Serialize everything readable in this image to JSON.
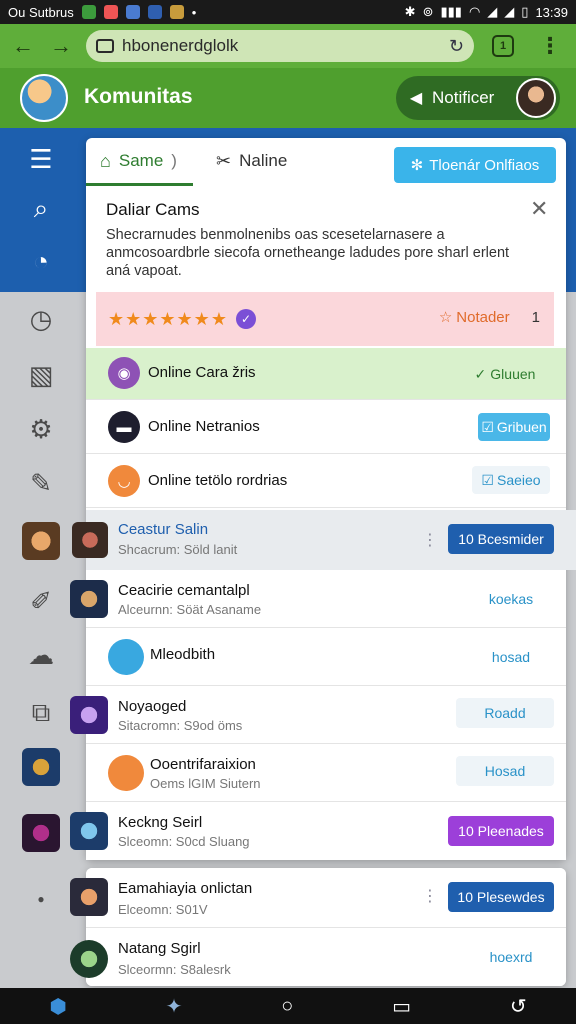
{
  "statusbar": {
    "carrier": "Ou Sutbrus",
    "time": "13:39"
  },
  "browser": {
    "url": "hbonenerdglolk"
  },
  "app": {
    "title": "Komunitas",
    "notif_label": "Notificer"
  },
  "tabs": [
    {
      "label": "Same",
      "active": true
    },
    {
      "label": "Naline",
      "active": false
    }
  ],
  "filter_button": "Tloenár Onlfiaos",
  "dialog": {
    "title": "Daliar Cams",
    "description": "Shecrarnudes benmolnenibs oas scesetelarnasere a anmcosoardbrle siecofa ornetheange ladudes pore sharl erlent aná vapoat."
  },
  "rating": {
    "stars": "★★★★★★★",
    "right_label": "Notader",
    "count": "1"
  },
  "online_rows": [
    {
      "label": "Online Cara žris",
      "action": "Gluuen",
      "icon_color": "#9b59b6"
    },
    {
      "label": "Online Netranios",
      "action": "Gribuen",
      "icon_color": "#1e1e2e"
    },
    {
      "label": "Online tetölo rordrias",
      "action": "Saeieo",
      "icon_color": "#f0893c"
    }
  ],
  "list": [
    {
      "name": "Ceastur Salin",
      "sub": "Shcacrum: Söld lanit",
      "button": "10 Bcesmider"
    },
    {
      "name": "Ceacirie cemantalpl",
      "sub": "Alceurnn: Söät Asaname",
      "button": "koekas"
    },
    {
      "name": "Mleodbith",
      "sub": "",
      "button": "hosad"
    },
    {
      "name": "Noyaoged",
      "sub": "Sitacromn: S9od öms",
      "button": "Roadd"
    },
    {
      "name": "Ooentrifaraixion",
      "sub": "Oems lGIM Siutern",
      "button": "Hosad"
    },
    {
      "name": "Keckng Seirl",
      "sub": "Slceomn: S0cd Sluang",
      "button": "10 Pleenades"
    },
    {
      "name": "Eamahiayia onlictan",
      "sub": "Elceomn: S01V",
      "button": "10 Plesewdes"
    },
    {
      "name": "Natang Sgirl",
      "sub": "Slceormn: S8alesrk",
      "button": "hoexrd"
    }
  ]
}
